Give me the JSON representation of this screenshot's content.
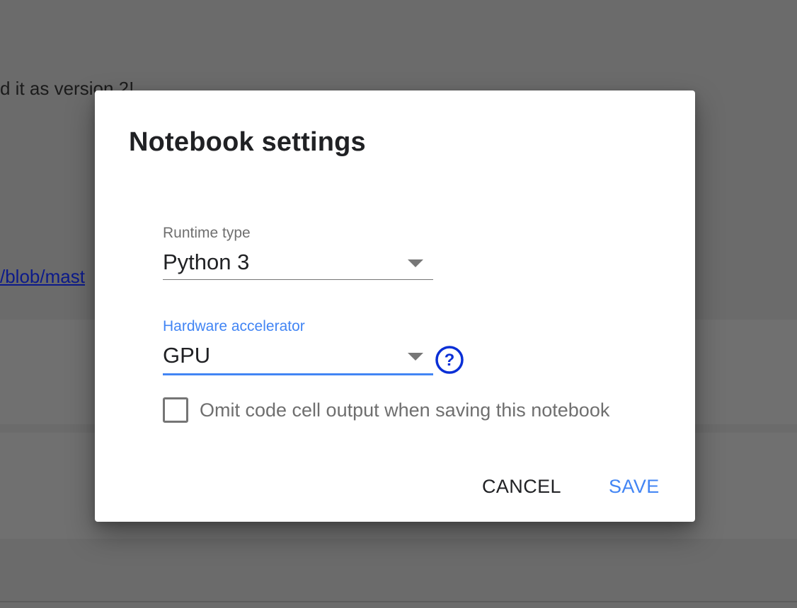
{
  "background": {
    "text_fragment": "d it as version 2!",
    "link_fragment": "/blob/mast"
  },
  "dialog": {
    "title": "Notebook settings",
    "runtime_type": {
      "label": "Runtime type",
      "value": "Python 3"
    },
    "hardware_accelerator": {
      "label": "Hardware accelerator",
      "value": "GPU",
      "help_icon": "help-circle-icon"
    },
    "omit_output": {
      "label": "Omit code cell output when saving this notebook",
      "checked": false
    },
    "buttons": {
      "cancel": "CANCEL",
      "save": "SAVE"
    }
  },
  "colors": {
    "accent": "#4285f4",
    "help_icon": "#0a2fd6",
    "overlay": "#6b6b6b"
  }
}
